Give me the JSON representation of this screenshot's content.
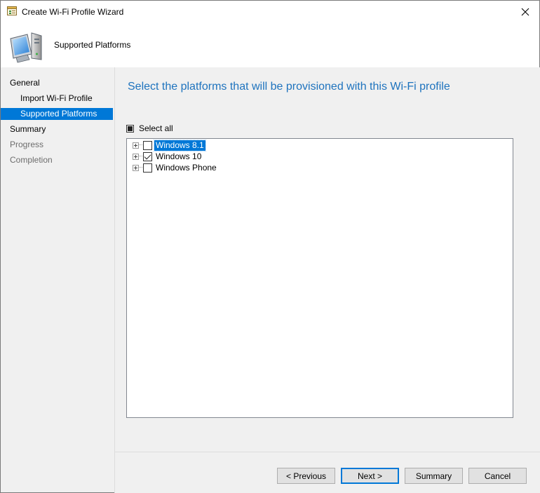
{
  "window": {
    "title": "Create Wi-Fi Profile Wizard"
  },
  "header": {
    "title": "Supported Platforms"
  },
  "sidebar": {
    "items": [
      {
        "label": "General"
      },
      {
        "label": "Import Wi-Fi Profile"
      },
      {
        "label": "Supported Platforms"
      },
      {
        "label": "Summary"
      },
      {
        "label": "Progress"
      },
      {
        "label": "Completion"
      }
    ]
  },
  "main": {
    "heading": "Select the platforms that will be provisioned with this Wi-Fi profile",
    "select_all_label": "Select all",
    "select_all_state": "indeterminate",
    "platforms": [
      {
        "label": "Windows 8.1",
        "checked": false,
        "selected": true
      },
      {
        "label": "Windows 10",
        "checked": true,
        "selected": false
      },
      {
        "label": "Windows Phone",
        "checked": false,
        "selected": false
      }
    ]
  },
  "footer": {
    "previous_label": "< Previous",
    "next_label": "Next >",
    "summary_label": "Summary",
    "cancel_label": "Cancel"
  },
  "colors": {
    "accent": "#0078d7",
    "heading": "#1e73be",
    "dim_text": "#6d6d6d"
  }
}
